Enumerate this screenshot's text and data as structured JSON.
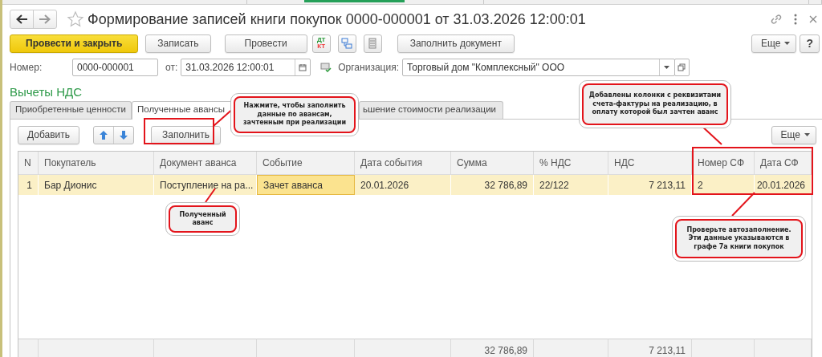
{
  "window": {
    "title": "Формирование записей книги покупок 0000-000001 от 31.03.2026 12:00:01"
  },
  "toolbar": {
    "buttons": [
      {
        "label": "Провести и закрыть",
        "kind": "primary"
      },
      {
        "label": "Записать",
        "kind": "normal"
      },
      {
        "label": "Провести",
        "kind": "normal"
      }
    ],
    "posting_icon": [
      "ДТ",
      "КТ"
    ],
    "fill_button": "Заполнить документ",
    "more_button": "Еще",
    "help_button": "?"
  },
  "fields": {
    "number": {
      "label": "Номер:",
      "value": "0000-000001"
    },
    "date": {
      "label": "от:",
      "value": "31.03.2026 12:00:01"
    },
    "organization": {
      "label": "Организация:",
      "value": "Торговый дом \"Комплексный\" ООО"
    }
  },
  "section_title": "Вычеты НДС",
  "tabs": [
    {
      "label": "Приобретенные ценности",
      "selected": false
    },
    {
      "label": "Полученные авансы",
      "selected": true
    },
    {
      "label": "ьшение стоимости реализации",
      "selected": false
    }
  ],
  "table_toolbar": {
    "add_button": "Добавить",
    "fill_button": "Заполнить",
    "more_button": "Еще"
  },
  "table": {
    "columns": [
      {
        "label": "N",
        "kind": "index"
      },
      {
        "label": "Покупатель",
        "kind": "text"
      },
      {
        "label": "Документ аванса",
        "kind": "text"
      },
      {
        "label": "Событие",
        "kind": "text"
      },
      {
        "label": "Дата события",
        "kind": "text"
      },
      {
        "label": "Сумма",
        "kind": "number",
        "total": "32 786,89"
      },
      {
        "label": "% НДС",
        "kind": "text"
      },
      {
        "label": "НДС",
        "kind": "number",
        "total": "7 213,11"
      },
      {
        "label": "Номер СФ",
        "kind": "text"
      },
      {
        "label": "Дата СФ",
        "kind": "number"
      }
    ],
    "rows": [
      {
        "selected": true,
        "cells": [
          {
            "text": "1",
            "active": false
          },
          {
            "text": "Бар Дионис",
            "active": false
          },
          {
            "text": "Поступление на ра...",
            "active": false
          },
          {
            "text": "Зачет аванса",
            "active": true
          },
          {
            "text": "20.01.2026",
            "active": false
          },
          {
            "text": "32 786,89",
            "active": false
          },
          {
            "text": "22/122",
            "active": false
          },
          {
            "text": "7 213,11",
            "active": false
          },
          {
            "text": "2",
            "active": false
          },
          {
            "text": "20.01.2026",
            "active": false
          }
        ]
      }
    ]
  },
  "callouts": [
    {
      "text": "Нажмите, чтобы заполнить данные по авансам, зачтенным при реализации"
    },
    {
      "text": "Полученный аванс"
    },
    {
      "text": "Добавлены колонки с реквизитами счета-фактуры на реализацию, в оплату которой был зачтен аванс"
    },
    {
      "text": "Проверьте автозаполнение. Эти данные указываются в графе 7а книги покупок"
    }
  ]
}
